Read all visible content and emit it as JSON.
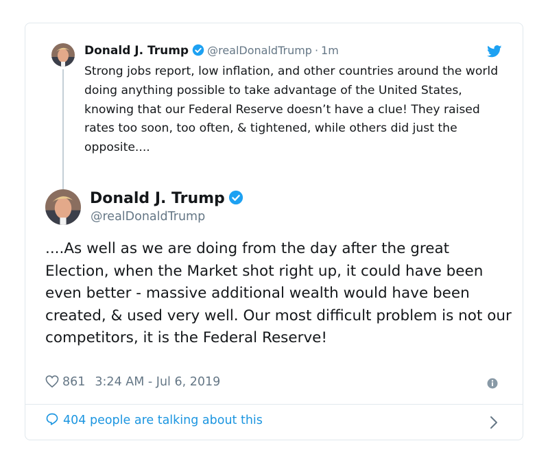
{
  "parent_tweet": {
    "name": "Donald J. Trump",
    "handle": "@realDonaldTrump",
    "separator": "·",
    "time": "1m",
    "text": "Strong jobs report, low inflation, and other countries around the world doing anything possible to take advantage of the United States, knowing that our Federal Reserve doesn’t have a clue! They raised rates too soon, too often, & tightened, while others did just the opposite...."
  },
  "main_tweet": {
    "name": "Donald J. Trump",
    "handle": "@realDonaldTrump",
    "text": "....As well as we are doing from the day after the great Election, when the Market shot right up, it could have been even better - massive additional wealth would have been created, & used very well. Our most difficult problem is not our competitors, it is the Federal Reserve!",
    "likes": "861",
    "timestamp": "3:24 AM - Jul 6, 2019"
  },
  "footer": {
    "label": "404 people are talking about this"
  },
  "icons": {
    "verified": "verified-badge-icon",
    "bird": "twitter-bird-icon",
    "heart": "heart-icon",
    "info": "info-icon",
    "bubble": "reply-bubble-icon",
    "chevron": "chevron-right-icon"
  },
  "colors": {
    "accent": "#1da1f2",
    "link": "#1b95e0",
    "muted": "#657786",
    "border": "#e1e8ed"
  }
}
